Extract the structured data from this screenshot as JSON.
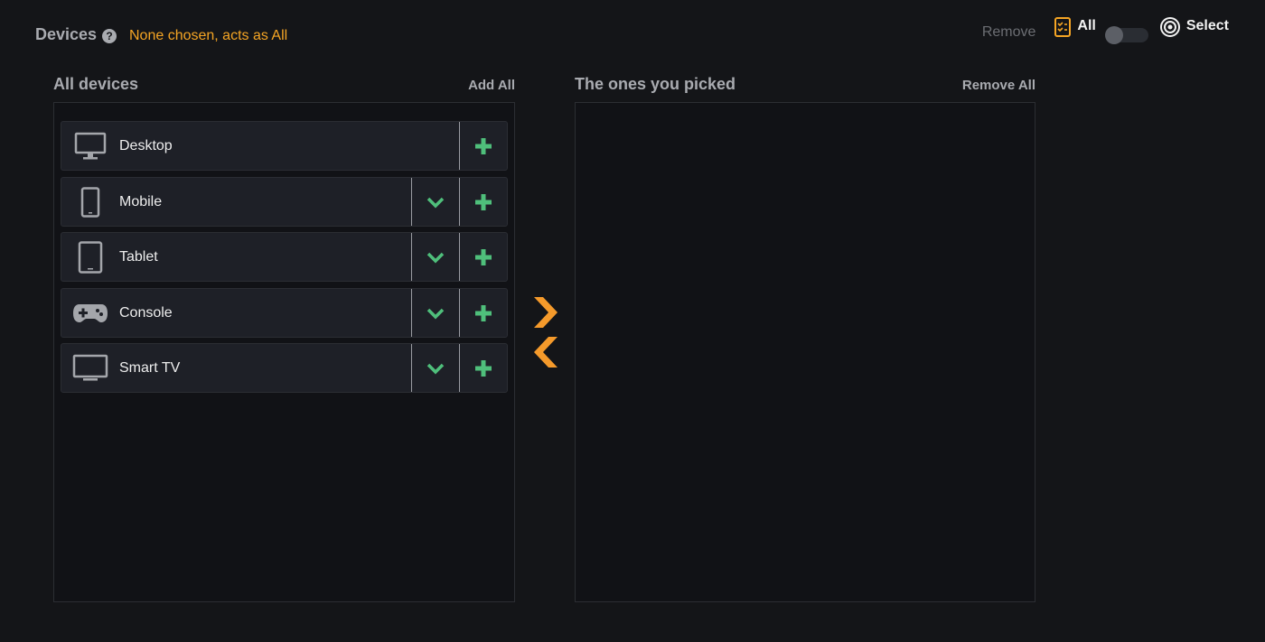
{
  "header": {
    "title": "Devices",
    "help": "?",
    "status": "None chosen, acts as All",
    "remove_label": "Remove",
    "mode_all_label": "All",
    "mode_select_label": "Select"
  },
  "left_panel": {
    "title": "All devices",
    "action": "Add All",
    "items": [
      {
        "label": "Desktop",
        "icon": "desktop-icon",
        "expandable": false
      },
      {
        "label": "Mobile",
        "icon": "mobile-icon",
        "expandable": true
      },
      {
        "label": "Tablet",
        "icon": "tablet-icon",
        "expandable": true
      },
      {
        "label": "Console",
        "icon": "gamepad-icon",
        "expandable": true
      },
      {
        "label": "Smart TV",
        "icon": "tv-icon",
        "expandable": true
      }
    ]
  },
  "right_panel": {
    "title": "The ones you picked",
    "action": "Remove All",
    "items": []
  },
  "colors": {
    "accent_orange": "#f5a524",
    "accent_green": "#4fbf7b",
    "background": "#141518"
  }
}
